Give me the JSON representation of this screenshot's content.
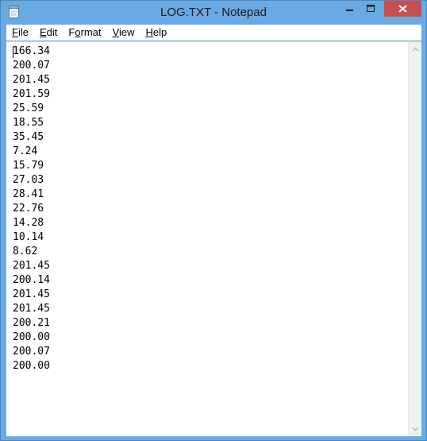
{
  "window": {
    "title": "LOG.TXT - Notepad"
  },
  "menu": {
    "items": [
      {
        "label": "File",
        "accel": "F"
      },
      {
        "label": "Edit",
        "accel": "E"
      },
      {
        "label": "Format",
        "accel": "o"
      },
      {
        "label": "View",
        "accel": "V"
      },
      {
        "label": "Help",
        "accel": "H"
      }
    ]
  },
  "editor": {
    "lines": [
      "166.34",
      "200.07",
      "201.45",
      "201.59",
      "25.59",
      "18.55",
      "35.45",
      "7.24",
      "15.79",
      "27.03",
      "28.41",
      "22.76",
      "14.28",
      "10.14",
      "8.62",
      "201.45",
      "200.14",
      "201.45",
      "201.45",
      "200.21",
      "200.00",
      "200.07",
      "200.00"
    ]
  },
  "colors": {
    "titlebar": "#6aaae3",
    "close_button": "#c7504f"
  },
  "icons": {
    "app": "notepad-icon",
    "minimize": "minimize-icon",
    "maximize": "maximize-icon",
    "close": "close-icon",
    "scroll_up": "chevron-up-icon",
    "scroll_down": "chevron-down-icon"
  }
}
